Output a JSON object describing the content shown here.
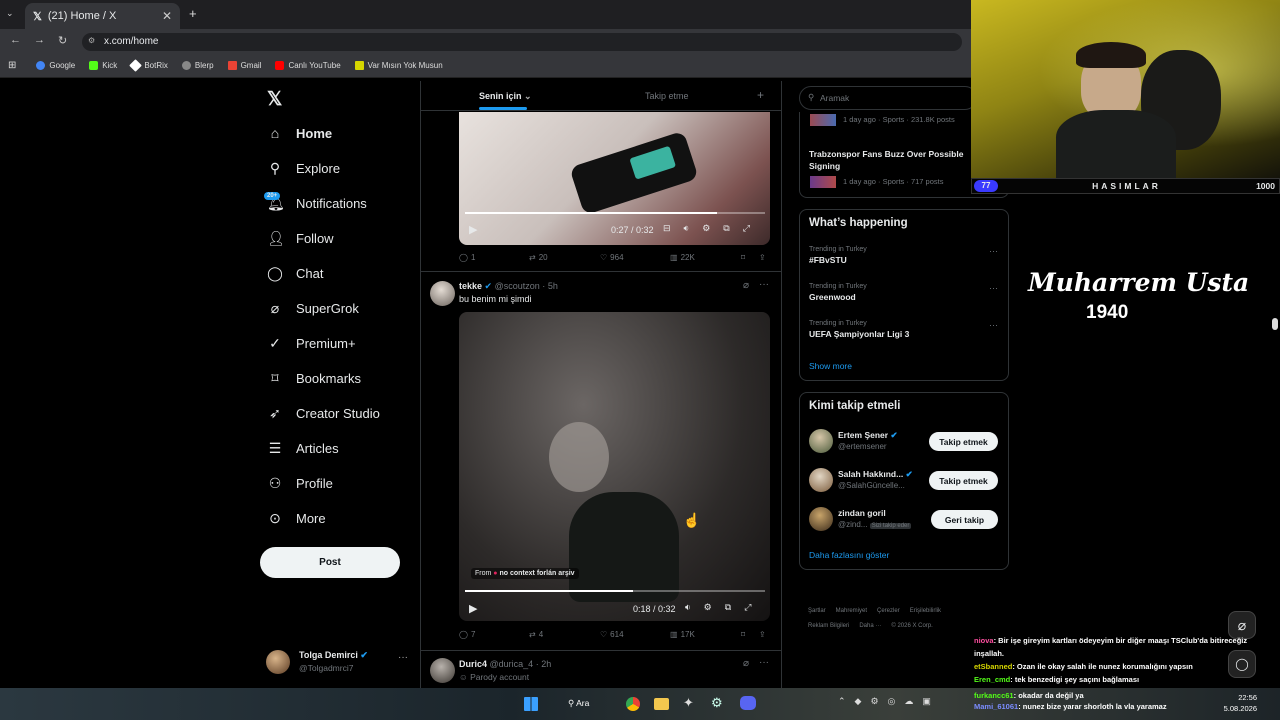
{
  "browser": {
    "tab_title": "(21) Home / X",
    "url": "x.com/home",
    "bookmarks": [
      {
        "label": "Google",
        "color": "#4285f4"
      },
      {
        "label": "Kick",
        "color": "#53fc18"
      },
      {
        "label": "BotRix",
        "color": "#ffffff"
      },
      {
        "label": "Blerp",
        "color": "#bbbbbb"
      },
      {
        "label": "Gmail",
        "color": "#ea4335"
      },
      {
        "label": "Canlı YouTube",
        "color": "#ff0000"
      },
      {
        "label": "Var Mısın Yok Musun",
        "color": "#d6d600"
      }
    ]
  },
  "sidebar": {
    "items": [
      {
        "label": "Home",
        "icon": "home-icon"
      },
      {
        "label": "Explore",
        "icon": "search-icon"
      },
      {
        "label": "Notifications",
        "icon": "bell-icon",
        "badge": "20+"
      },
      {
        "label": "Follow",
        "icon": "person-plus-icon"
      },
      {
        "label": "Chat",
        "icon": "chat-icon"
      },
      {
        "label": "SuperGrok",
        "icon": "grok-icon"
      },
      {
        "label": "Premium+",
        "icon": "verified-icon"
      },
      {
        "label": "Bookmarks",
        "icon": "bookmark-icon"
      },
      {
        "label": "Creator Studio",
        "icon": "rocket-icon"
      },
      {
        "label": "Articles",
        "icon": "article-icon"
      },
      {
        "label": "Profile",
        "icon": "person-icon"
      },
      {
        "label": "More",
        "icon": "more-icon"
      }
    ],
    "post_label": "Post",
    "account_name": "Tolga Demirci",
    "account_handle": "@Tolgadmrci7"
  },
  "feed": {
    "tab_for_you": "Senin için",
    "tab_following": "Takip etme",
    "tweet1": {
      "time": "0:27 / 0:32",
      "replies": "1",
      "retweets": "20",
      "likes": "964",
      "views": "22K",
      "progress": 0.84
    },
    "tweet2": {
      "name": "tekke",
      "handle": "@scoutzon",
      "time_ago": "5h",
      "text": "bu benim mi şimdi",
      "from_label": "From",
      "from_source": "no context forlán arşiv",
      "time": "0:18 / 0:32",
      "replies": "7",
      "retweets": "4",
      "likes": "614",
      "views": "17K",
      "progress": 0.56
    },
    "tweet3": {
      "name": "Duric4",
      "handle": "@durica_4",
      "time_ago": "2h",
      "text": "Parody account"
    }
  },
  "right": {
    "search_placeholder": "Aramak",
    "news": [
      {
        "meta": "1 day ago · Sports · 231.8K posts"
      },
      {
        "title": "Trabzonspor Fans Buzz Over Possible Signing",
        "meta": "1 day ago · Sports · 717 posts"
      }
    ],
    "happening_title": "What’s happening",
    "trends": [
      {
        "context": "Trending in Turkey",
        "name": "#FBvSTU"
      },
      {
        "context": "Trending in Turkey",
        "name": "Greenwood"
      },
      {
        "context": "Trending in Turkey",
        "name": "UEFA Şampiyonlar Ligi 3"
      }
    ],
    "show_more": "Show more",
    "who_title": "Kimi takip etmeli",
    "suggestions": [
      {
        "name": "Ertem Şener",
        "handle": "@ertemsener",
        "button": "Takip etmek",
        "verified": true
      },
      {
        "name": "Salah Hakkınd...",
        "handle": "@SalahGüncelle...",
        "button": "Takip etmek",
        "verified": true
      },
      {
        "name": "zindan goril",
        "handle": "@zind...",
        "button": "Geri takip",
        "follows_you": "Sizi takip eder",
        "verified": false
      }
    ],
    "more_link": "Daha fazlasını göster",
    "footer_row1": [
      "Şartlar",
      "Mahremiyet",
      "Çerezler",
      "Erişilebilirlik"
    ],
    "footer_row2": [
      "Reklam Bilgileri",
      "Daha ···",
      "© 2026 X Corp."
    ]
  },
  "stream": {
    "bar_left": "77",
    "bar_title": "HASIMLAR",
    "bar_right": "1000",
    "logo_text": "Muharrem Usta",
    "logo_year": "1940",
    "chat": [
      {
        "user": "niova",
        "color": "#ff4fa0",
        "text": ": Bir işe gireyim kartları ödeyeyim bir diğer maaşı TSClub'da bitireceğiz inşallah."
      },
      {
        "user": "etSbanned",
        "color": "#d6d600",
        "text": ": Ozan ile okay salah ile nunez korumalığını yapsın"
      },
      {
        "user": "Eren_cmd",
        "color": "#53fc18",
        "text": ": tek benzedigi şey saçını bağlaması"
      },
      {
        "user": "furkancc61",
        "color": "#53fc18",
        "text": ": okadar da değil ya"
      },
      {
        "user": "Mami_61061",
        "color": "#7b8cff",
        "text": ": nunez bize yarar shorloth la vla yaramaz"
      }
    ]
  },
  "taskbar": {
    "search_label": "Ara",
    "time": "22:56",
    "date": "5.08.2026"
  }
}
